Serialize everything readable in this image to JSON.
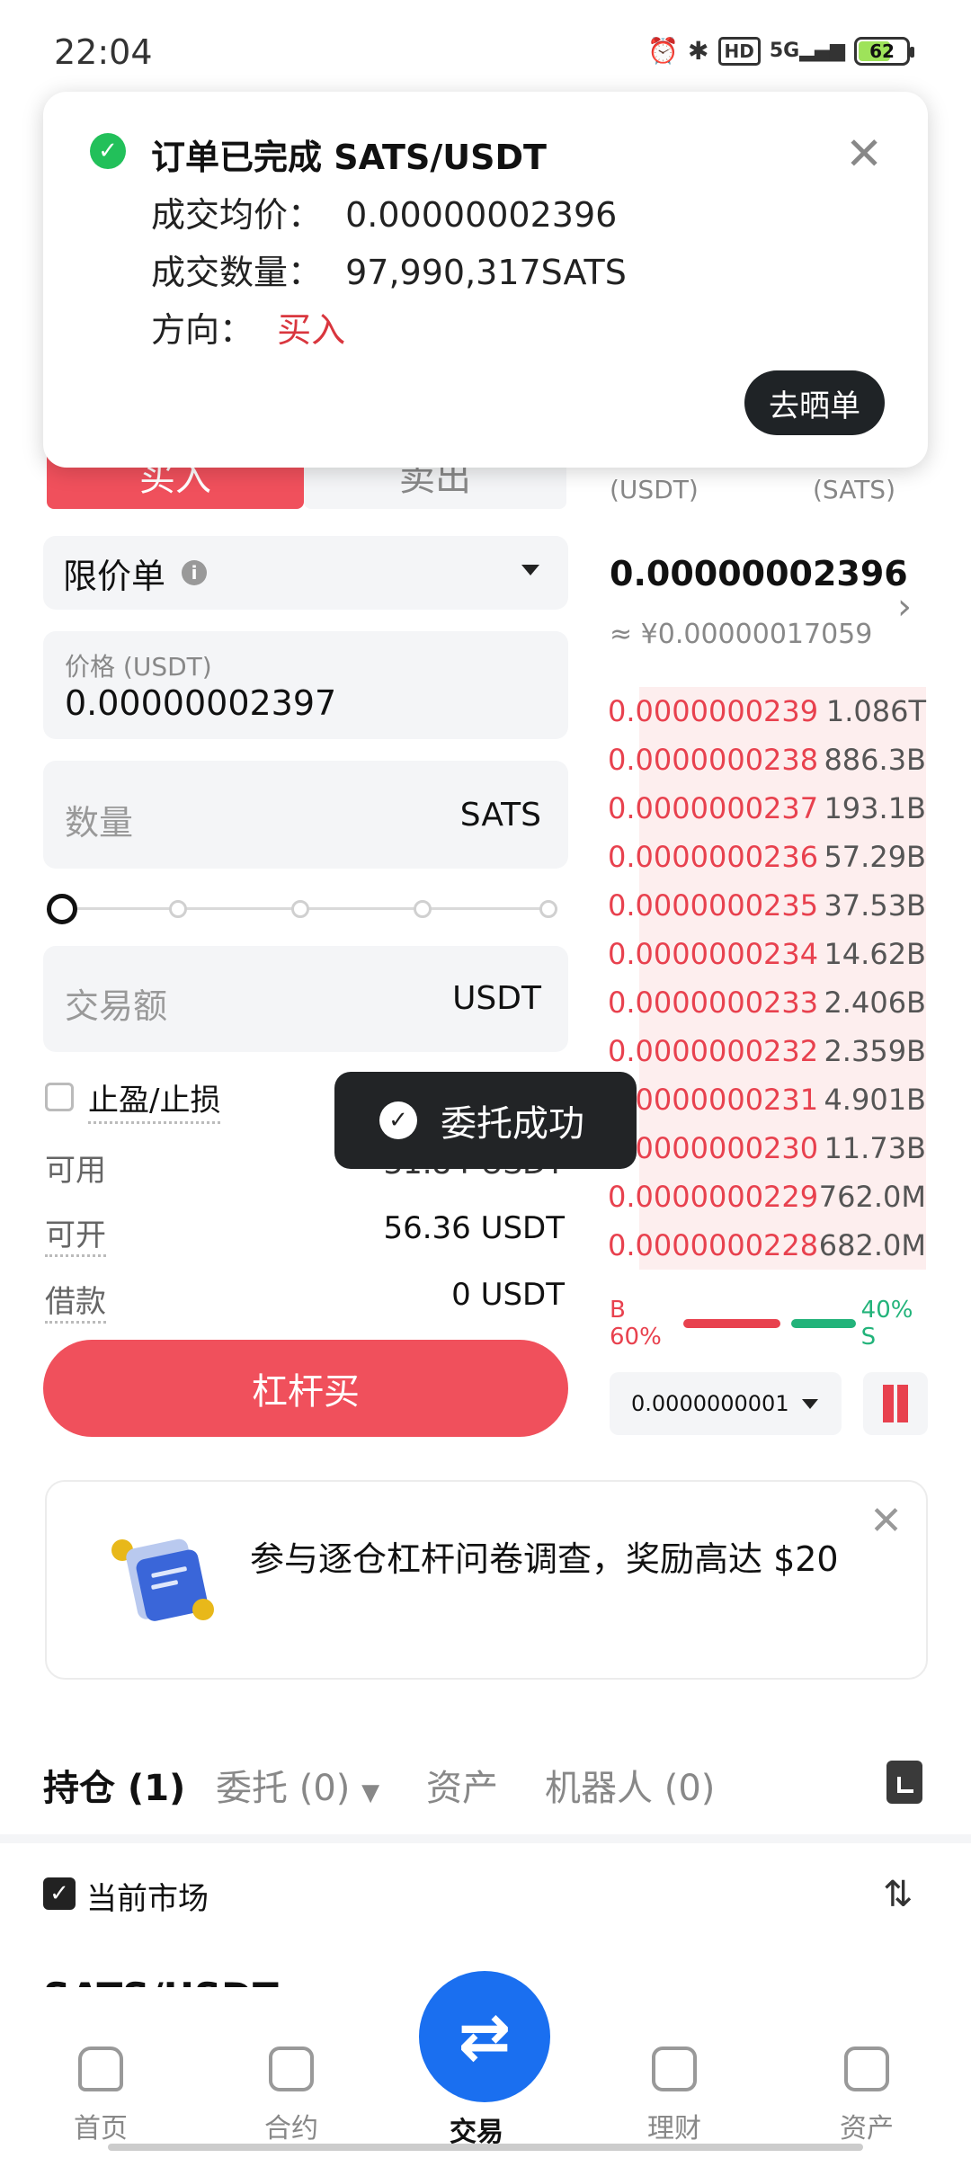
{
  "status_bar": {
    "time": "22:04",
    "hd": "HD",
    "network": "5G",
    "battery": "62"
  },
  "notification": {
    "title": "订单已完成 SATS/USDT",
    "avg_price_label": "成交均价：",
    "avg_price": "0.00000002396",
    "qty_label": "成交数量：",
    "qty": "97,990,317SATS",
    "side_label": "方向：",
    "side": "买入",
    "share_button": "去晒单",
    "close_icon": "close-icon"
  },
  "trade_form": {
    "buy_tab": "买入",
    "sell_tab": "卖出",
    "order_type": "限价单",
    "price_label": "价格 (USDT)",
    "price_value": "0.00000002397",
    "qty_placeholder": "数量",
    "qty_unit": "SATS",
    "slider_percent": 0,
    "amount_placeholder": "交易额",
    "amount_unit": "USDT",
    "tpsl_label": "止盈/止损",
    "available_label": "可用",
    "available_value": "31.84 USDT",
    "openable_label": "可开",
    "openable_value": "56.36 USDT",
    "borrow_label": "借款",
    "borrow_value": "0 USDT",
    "leverage_buy_button": "杠杆买"
  },
  "toast": {
    "text": "委托成功"
  },
  "order_book": {
    "price_header": "(USDT)",
    "qty_header": "(SATS)",
    "last_price": "0.00000002396",
    "last_price_cny": "≈ ¥0.00000017059",
    "asks": [
      {
        "price": "0.0000000239",
        "qty": "1.086T",
        "depth": 0.9
      },
      {
        "price": "0.0000000238",
        "qty": "886.3B",
        "depth": 0.9
      },
      {
        "price": "0.0000000237",
        "qty": "193.1B",
        "depth": 0.9
      },
      {
        "price": "0.0000000236",
        "qty": "57.29B",
        "depth": 0.9
      },
      {
        "price": "0.0000000235",
        "qty": "37.53B",
        "depth": 0.9
      },
      {
        "price": "0.0000000234",
        "qty": "14.62B",
        "depth": 0.9
      },
      {
        "price": "0.0000000233",
        "qty": "2.406B",
        "depth": 0.9
      },
      {
        "price": "0.0000000232",
        "qty": "2.359B",
        "depth": 0.9
      },
      {
        "price": "0.0000000231",
        "qty": "4.901B",
        "depth": 0.9
      },
      {
        "price": "0.0000000230",
        "qty": "11.73B",
        "depth": 0.9
      },
      {
        "price": "0.0000000229",
        "qty": "762.0M",
        "depth": 0.9
      },
      {
        "price": "0.0000000228",
        "qty": "682.0M",
        "depth": 0.9
      }
    ],
    "ratio_buy": "B 60%",
    "ratio_sell": "40% S",
    "ratio_buy_fraction": 0.6,
    "precision": "0.0000000001",
    "buy_color": "#e8414e",
    "sell_color": "#22b37a"
  },
  "banner": {
    "text": "参与逐仓杠杆问卷调查，奖励高达 $20"
  },
  "bottom_tabs": {
    "positions": "持仓 (1)",
    "orders": "委托 (0)",
    "assets": "资产",
    "bots": "机器人 (0)",
    "current_market": "当前市场",
    "pair": "SATS/USDT"
  },
  "nav": {
    "home": "首页",
    "futures": "合约",
    "trade": "交易",
    "earn": "理财",
    "assets": "资产"
  },
  "colors": {
    "accent": "#f0505c",
    "primary_blue": "#1a6ff0"
  }
}
